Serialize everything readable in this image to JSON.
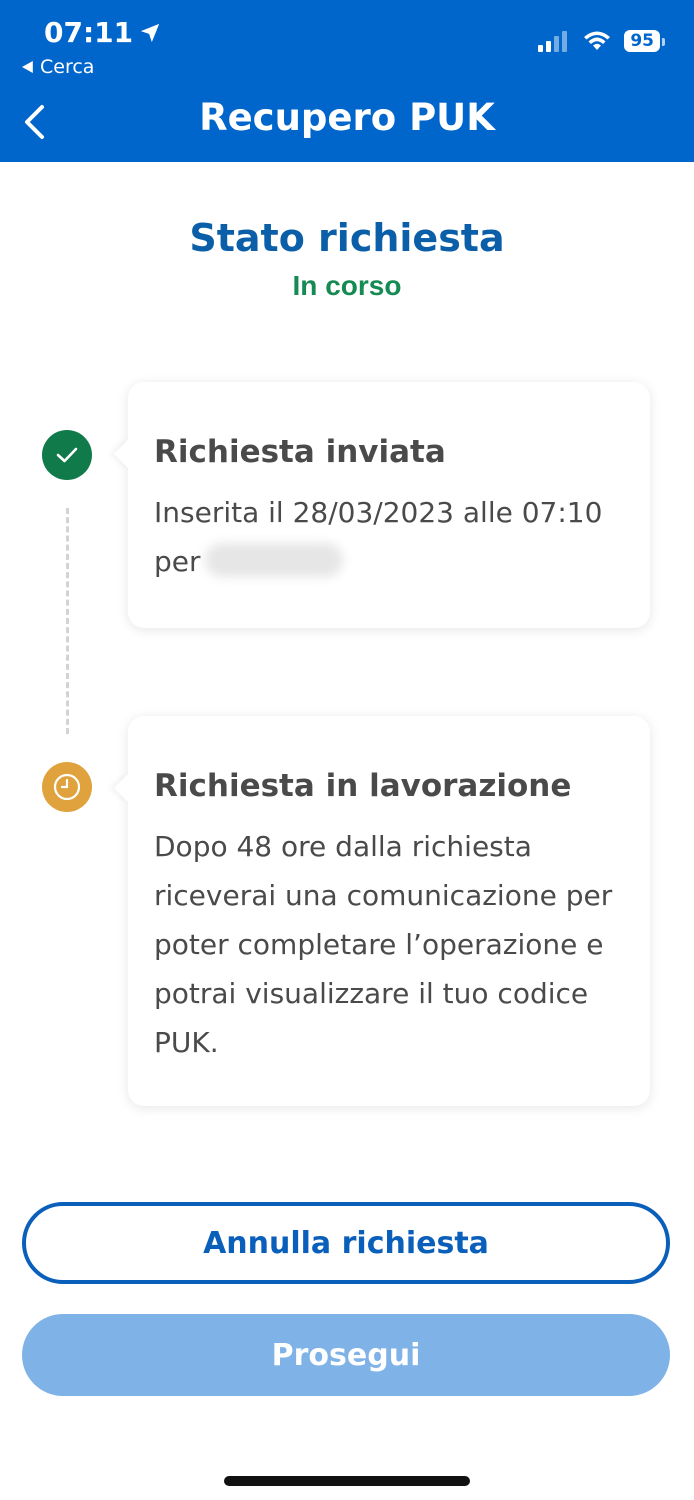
{
  "status_bar": {
    "time": "07:11",
    "back_app_label": "Cerca",
    "battery": "95"
  },
  "nav": {
    "title": "Recupero PUK"
  },
  "request_state": {
    "title": "Stato richiesta",
    "value": "In corso"
  },
  "steps": [
    {
      "title": "Richiesta inviata",
      "text": "Inserita il 28/03/2023 alle 07:10",
      "text_suffix": "per"
    },
    {
      "title": "Richiesta in lavorazione",
      "text": "Dopo 48 ore dalla richiesta riceverai una comunicazione per poter completare l’operazione e potrai visualizzare il tuo codice PUK."
    }
  ],
  "buttons": {
    "cancel": "Annulla richiesta",
    "continue": "Prosegui"
  },
  "colors": {
    "header_bg": "#0066cc",
    "success": "#117a4a",
    "pending": "#e0a23c",
    "primary": "#0a5fba",
    "disabled_button": "#7fb2e6"
  }
}
